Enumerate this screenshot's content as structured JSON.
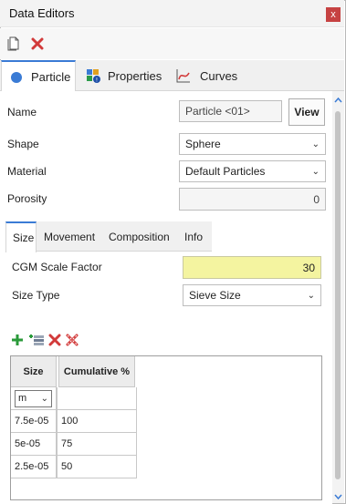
{
  "window": {
    "title": "Data Editors",
    "close_glyph": "x"
  },
  "toolbar": {
    "new_icon": "new-document-icon",
    "delete_icon": "delete-icon"
  },
  "main_tabs": [
    {
      "label": "Particle",
      "icon": "circle-icon"
    },
    {
      "label": "Properties",
      "icon": "properties-grid-icon"
    },
    {
      "label": "Curves",
      "icon": "curve-chart-icon"
    }
  ],
  "form": {
    "name_label": "Name",
    "name_value": "Particle <01>",
    "view_button": "View",
    "shape_label": "Shape",
    "shape_value": "Sphere",
    "material_label": "Material",
    "material_value": "Default Particles",
    "porosity_label": "Porosity",
    "porosity_value": "0"
  },
  "sub_tabs": [
    "Size",
    "Movement",
    "Composition",
    "Info"
  ],
  "size": {
    "cgm_label": "CGM Scale Factor",
    "cgm_value": "30",
    "size_type_label": "Size Type",
    "size_type_value": "Sieve Size"
  },
  "grid": {
    "columns": [
      "Size",
      "Cumulative %"
    ],
    "unit": "m",
    "rows": [
      {
        "size": "7.5e-05",
        "cumulative": "100"
      },
      {
        "size": "5e-05",
        "cumulative": "75"
      },
      {
        "size": "2.5e-05",
        "cumulative": "50"
      }
    ]
  },
  "colors": {
    "accent": "#3a7bd5",
    "highlight_field": "#f4f4a0",
    "close": "#c64242"
  }
}
